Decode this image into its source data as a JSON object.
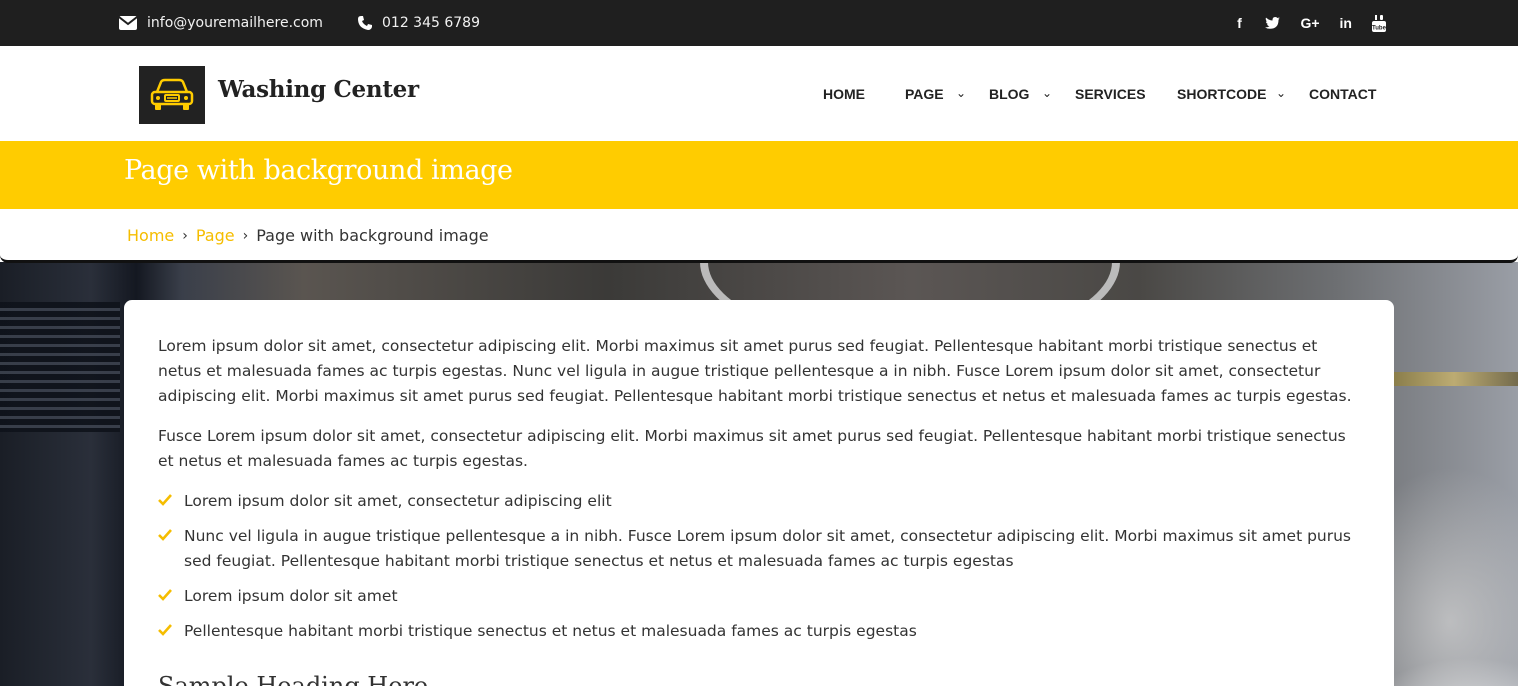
{
  "topbar": {
    "email": "info@youremailhere.com",
    "phone": "012 345 6789",
    "social": [
      {
        "icon": "facebook-icon",
        "glyph": "f"
      },
      {
        "icon": "twitter-icon",
        "glyph": "🐦"
      },
      {
        "icon": "google-plus-icon",
        "glyph": "G+"
      },
      {
        "icon": "linkedin-icon",
        "glyph": "in"
      },
      {
        "icon": "youtube-icon",
        "glyph": "▶"
      }
    ]
  },
  "header": {
    "brand": "Washing Center",
    "nav": [
      {
        "label": "HOME",
        "has_dropdown": false
      },
      {
        "label": "PAGE",
        "has_dropdown": true
      },
      {
        "label": "BLOG",
        "has_dropdown": true
      },
      {
        "label": "SERVICES",
        "has_dropdown": false
      },
      {
        "label": "SHORTCODE",
        "has_dropdown": true
      },
      {
        "label": "CONTACT",
        "has_dropdown": false
      }
    ],
    "chevron": "⌄"
  },
  "title": "Page with background image",
  "breadcrumb": {
    "items": [
      "Home",
      "Page"
    ],
    "separator": "›",
    "current": "Page with background image"
  },
  "content": {
    "p1": "Lorem ipsum dolor sit amet, consectetur adipiscing elit. Morbi maximus sit amet purus sed feugiat. Pellentesque habitant morbi tristique senectus et netus et malesuada fames ac turpis egestas. Nunc vel ligula in augue tristique pellentesque a in nibh. Fusce Lorem ipsum dolor sit amet, consectetur adipiscing elit. Morbi maximus sit amet purus sed feugiat. Pellentesque habitant morbi tristique senectus et netus et malesuada fames ac turpis egestas.",
    "p2": "Fusce Lorem ipsum dolor sit amet, consectetur adipiscing elit. Morbi maximus sit amet purus sed feugiat. Pellentesque habitant morbi tristique senectus et netus et malesuada fames ac turpis egestas.",
    "list": [
      "Lorem ipsum dolor sit amet, consectetur adipiscing elit",
      "Nunc vel ligula in augue tristique pellentesque a in nibh. Fusce Lorem ipsum dolor sit amet, consectetur adipiscing elit. Morbi maximus sit amet purus sed feugiat. Pellentesque habitant morbi tristique senectus et netus et malesuada fames ac turpis egestas",
      "Lorem ipsum dolor sit amet",
      "Pellentesque habitant morbi tristique senectus et netus et malesuada fames ac turpis egestas"
    ],
    "heading": "Sample Heading Here"
  },
  "colors": {
    "accent": "#ffcc00",
    "link": "#f5bd00",
    "topbar": "#1f1f1f",
    "check": "#f5bd00"
  }
}
